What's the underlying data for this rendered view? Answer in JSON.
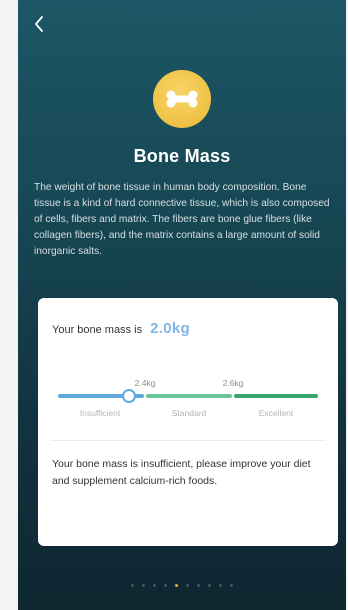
{
  "header": {
    "back_icon": "chevron-left-icon"
  },
  "metric": {
    "icon": "bone-icon",
    "title": "Bone Mass",
    "description": "The weight of bone tissue in human body composition. Bone tissue is a kind of hard connective tissue, which is also composed of cells, fibers and matrix. The fibers are bone glue fibers (like collagen fibers), and the matrix contains a large amount of solid inorganic salts."
  },
  "card": {
    "label": "Your bone mass is",
    "value": "2.0kg",
    "scale": {
      "thresholds": [
        "2.4kg",
        "2.6kg"
      ],
      "ranges": [
        "Insufficient",
        "Standard",
        "Excellent"
      ],
      "colors": {
        "insufficient": "#5fa9dd",
        "standard": "#6ac59a",
        "excellent": "#37a56b"
      }
    },
    "advice": "Your bone mass is insufficient, please improve your diet and supplement calcium-rich foods."
  },
  "pager": {
    "count": 10,
    "active": 4
  },
  "colors": {
    "value": "#7fb6e6",
    "badge": "#f0c44a",
    "active_dot": "#f2a33a"
  }
}
